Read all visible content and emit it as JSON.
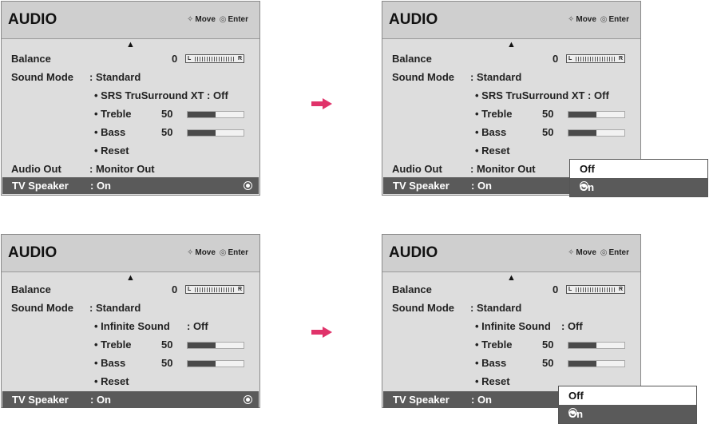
{
  "panels": [
    {
      "title": "AUDIO",
      "nav": {
        "move": "Move",
        "enter": "Enter"
      },
      "balance": {
        "label": "Balance",
        "value": "0",
        "left": "L",
        "right": "R"
      },
      "sound_mode": {
        "label": "Sound Mode",
        "value": ": Standard"
      },
      "sub": [
        {
          "label": "• SRS TruSurround XT : Off"
        },
        {
          "label": "• Treble",
          "value": "50",
          "level": 0.5
        },
        {
          "label": "• Bass",
          "value": "50",
          "level": 0.5
        },
        {
          "label": "• Reset"
        }
      ],
      "audio_out": {
        "label": "Audio Out",
        "value": ": Monitor Out"
      },
      "tv_speaker": {
        "label": "TV Speaker",
        "value": ": On"
      }
    },
    {
      "title": "AUDIO",
      "nav": {
        "move": "Move",
        "enter": "Enter"
      },
      "balance": {
        "label": "Balance",
        "value": "0",
        "left": "L",
        "right": "R"
      },
      "sound_mode": {
        "label": "Sound Mode",
        "value": ": Standard"
      },
      "sub": [
        {
          "label": "• SRS TruSurround XT : Off"
        },
        {
          "label": "• Treble",
          "value": "50",
          "level": 0.5
        },
        {
          "label": "• Bass",
          "value": "50",
          "level": 0.5
        },
        {
          "label": "• Reset"
        }
      ],
      "audio_out": {
        "label": "Audio Out",
        "value": ": Monitor Out"
      },
      "tv_speaker": {
        "label": "TV Speaker",
        "value": ": On"
      },
      "popup": [
        "Off",
        "On"
      ]
    },
    {
      "title": "AUDIO",
      "nav": {
        "move": "Move",
        "enter": "Enter"
      },
      "balance": {
        "label": "Balance",
        "value": "0",
        "left": "L",
        "right": "R"
      },
      "sound_mode": {
        "label": "Sound Mode",
        "value": ": Standard"
      },
      "sub": [
        {
          "label": "• Infinite Sound",
          "value": ": Off"
        },
        {
          "label": "• Treble",
          "value": "50",
          "level": 0.5
        },
        {
          "label": "• Bass",
          "value": "50",
          "level": 0.5
        },
        {
          "label": "• Reset"
        }
      ],
      "tv_speaker": {
        "label": "TV Speaker",
        "value": ": On"
      }
    },
    {
      "title": "AUDIO",
      "nav": {
        "move": "Move",
        "enter": "Enter"
      },
      "balance": {
        "label": "Balance",
        "value": "0",
        "left": "L",
        "right": "R"
      },
      "sound_mode": {
        "label": "Sound Mode",
        "value": ": Standard"
      },
      "sub": [
        {
          "label": "• Infinite Sound",
          "value": ": Off"
        },
        {
          "label": "• Treble",
          "value": "50",
          "level": 0.5
        },
        {
          "label": "• Bass",
          "value": "50",
          "level": 0.5
        },
        {
          "label": "• Reset"
        }
      ],
      "tv_speaker": {
        "label": "TV Speaker",
        "value": ": On"
      },
      "popup": [
        "Off",
        "On"
      ]
    }
  ],
  "colors": {
    "arrow": "#e0336a",
    "highlight": "#5a5a5a",
    "panel_bg": "#dddddd"
  }
}
